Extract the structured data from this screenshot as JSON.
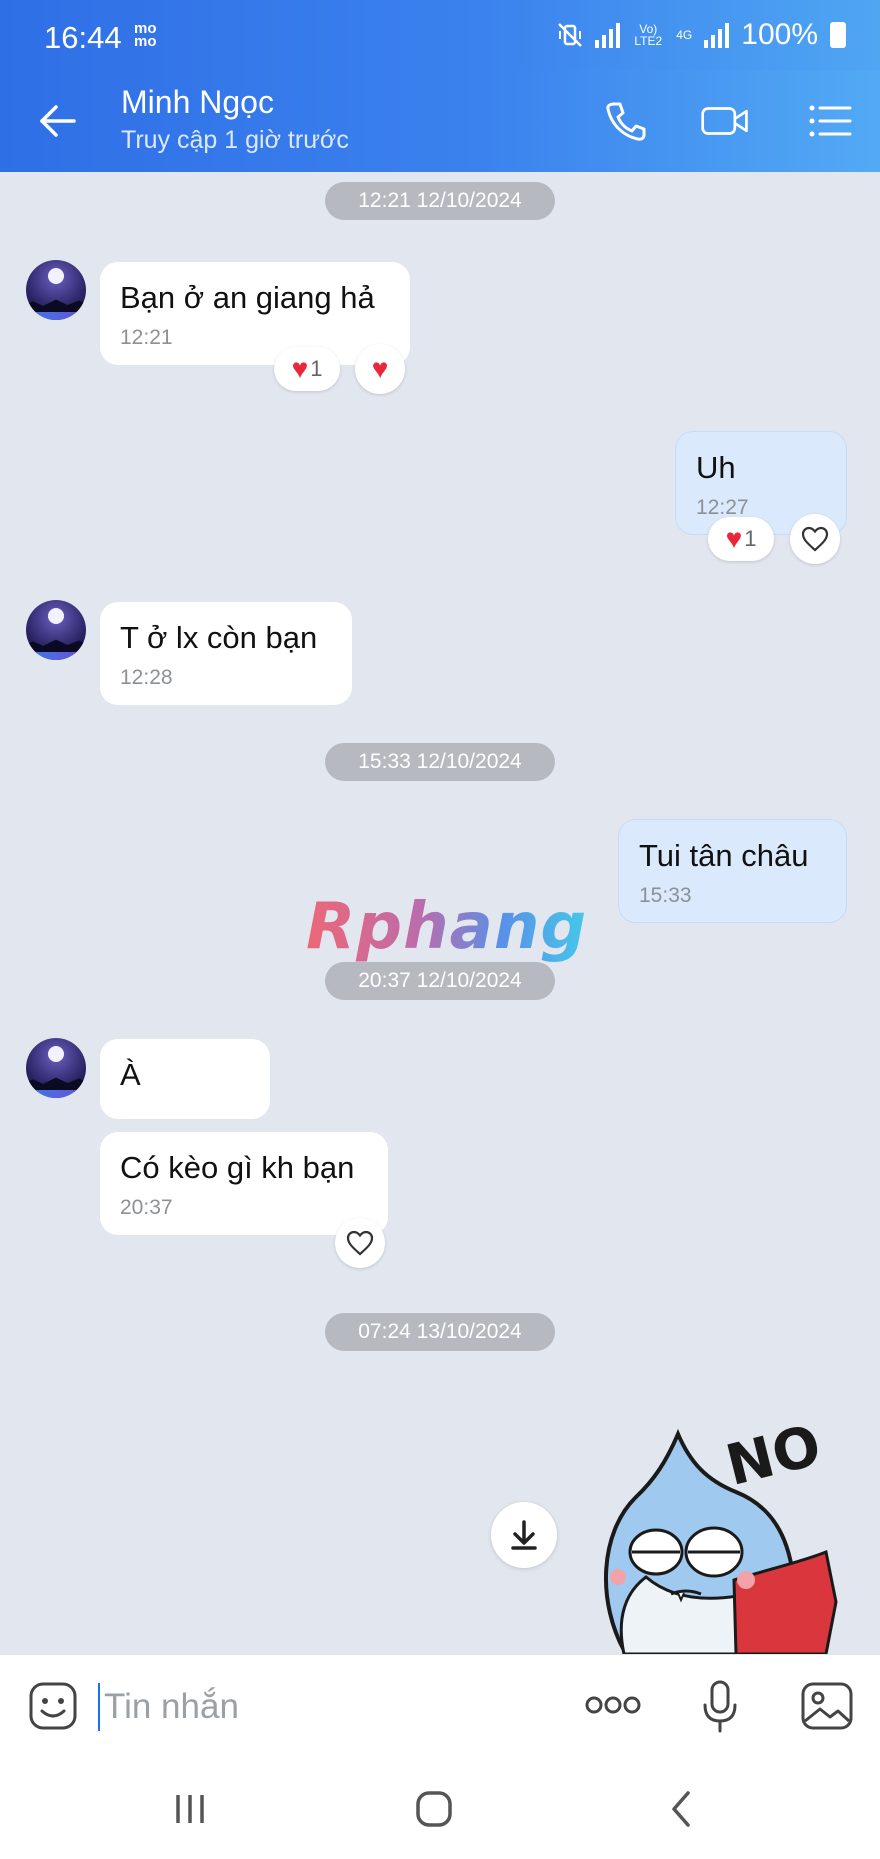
{
  "status_bar": {
    "time": "16:44",
    "app_badge": "mo mo",
    "volte_label": "Vo) LTE2",
    "network_label": "4G",
    "battery": "100%"
  },
  "header": {
    "name": "Minh Ngọc",
    "status": "Truy cập 1 giờ trước",
    "icons": [
      "back-arrow-icon",
      "phone-icon",
      "video-call-icon",
      "menu-list-icon"
    ]
  },
  "chat": {
    "date_separators": [
      "12:21 12/10/2024",
      "15:33 12/10/2024",
      "20:37 12/10/2024",
      "07:24 13/10/2024"
    ],
    "messages": [
      {
        "from": "contact",
        "text": "Bạn ở an giang hả",
        "time": "12:21",
        "reaction_count": "1"
      },
      {
        "from": "me",
        "text": "Uh",
        "time": "12:27",
        "reaction_count": "1"
      },
      {
        "from": "contact",
        "text": "T ở lx còn bạn",
        "time": "12:28"
      },
      {
        "from": "me",
        "text": "Tui tân châu",
        "time": "15:33"
      },
      {
        "from": "contact",
        "text": "À"
      },
      {
        "from": "contact",
        "text": "Có kèo gì kh bạn",
        "time": "20:37"
      }
    ],
    "watermark": "Rphang",
    "sticker_text": "NO"
  },
  "input_bar": {
    "placeholder": "Tin nhắn",
    "icons": [
      "emoji-icon",
      "more-options-icon",
      "microphone-icon",
      "image-icon"
    ]
  },
  "colors": {
    "header_gradient_start": "#2f6fe6",
    "header_gradient_end": "#52aaf4",
    "chat_background": "#e2e6ee",
    "outgoing_bubble": "#daeafc",
    "incoming_bubble": "#ffffff",
    "heart": "#e8283a"
  }
}
